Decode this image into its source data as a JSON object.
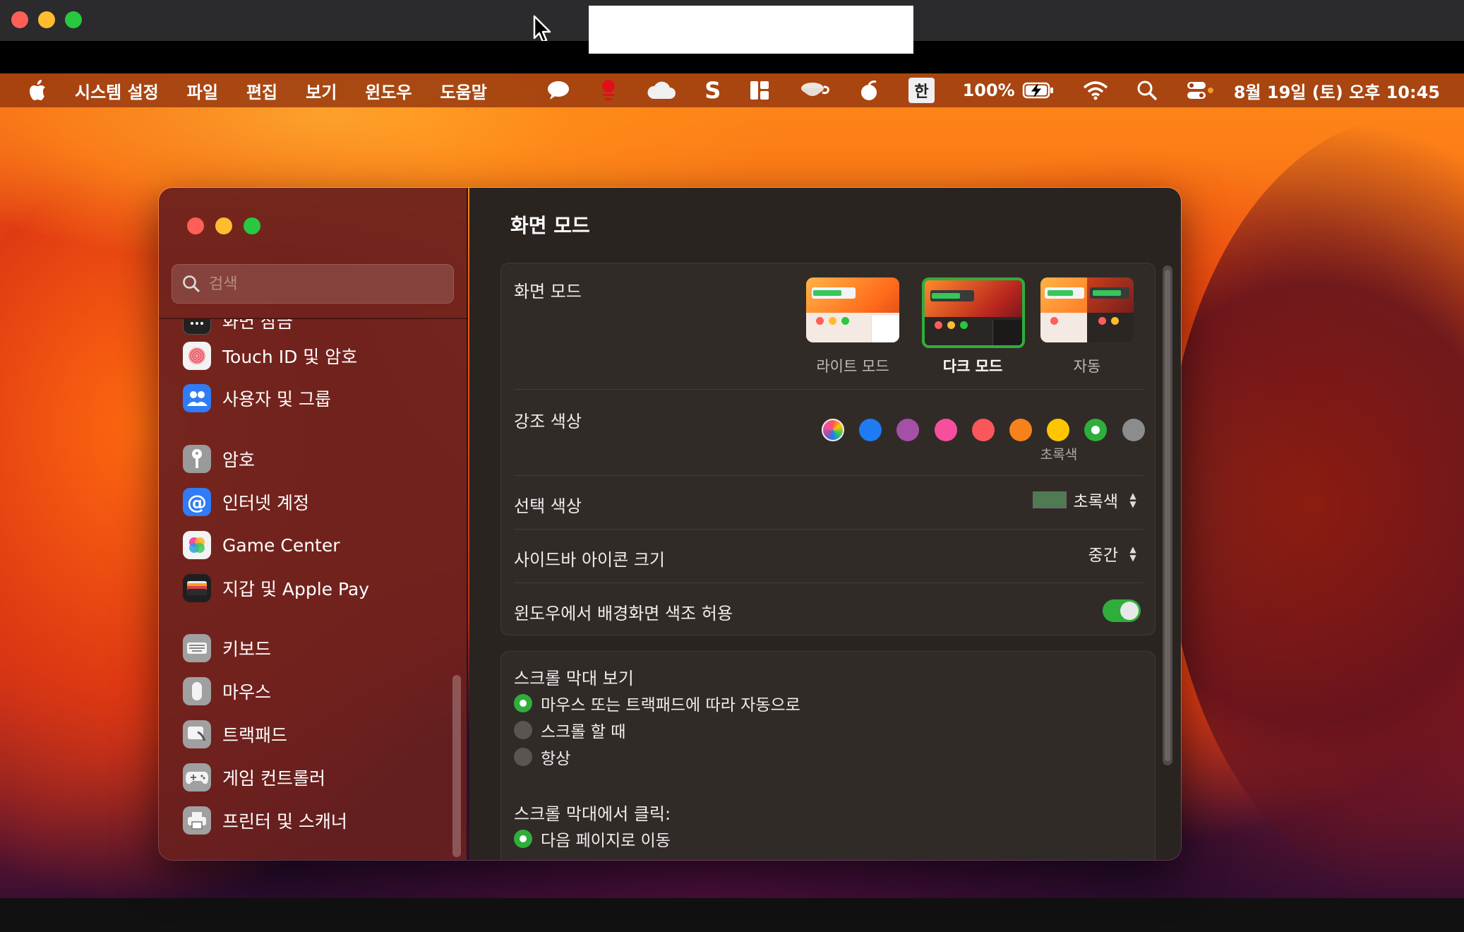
{
  "colors": {
    "accent_green": "#2fae3c",
    "tl_red": "#ff5f57",
    "tl_yellow": "#febc2e",
    "tl_green": "#28c840"
  },
  "menubar": {
    "app": "시스템 설정",
    "menus": [
      "파일",
      "편집",
      "보기",
      "윈도우",
      "도움말"
    ],
    "input_method": "한",
    "battery": "100%",
    "datetime": "8월 19일 (토) 오후 10:45"
  },
  "sidebar": {
    "search_placeholder": "검색",
    "items": [
      {
        "label": "화면 잠금",
        "icon": "lock-screen-icon",
        "color": "#222222"
      },
      {
        "label": "Touch ID 및 암호",
        "icon": "fingerprint-icon",
        "color": "#f2f2f2"
      },
      {
        "label": "사용자 및 그룹",
        "icon": "users-icon",
        "color": "#2f7cf6"
      },
      {
        "label": "암호",
        "icon": "key-icon",
        "color": "#9a9a9a"
      },
      {
        "label": "인터넷 계정",
        "icon": "at-icon",
        "color": "#2f7cf6"
      },
      {
        "label": "Game Center",
        "icon": "game-center-icon",
        "color": "#f2f2f2"
      },
      {
        "label": "지갑 및 Apple Pay",
        "icon": "wallet-icon",
        "color": "#1f1f1f"
      },
      {
        "label": "키보드",
        "icon": "keyboard-icon",
        "color": "#9a9a9a"
      },
      {
        "label": "마우스",
        "icon": "mouse-icon",
        "color": "#9a9a9a"
      },
      {
        "label": "트랙패드",
        "icon": "trackpad-icon",
        "color": "#9a9a9a"
      },
      {
        "label": "게임 컨트롤러",
        "icon": "gamepad-icon",
        "color": "#9a9a9a"
      },
      {
        "label": "프린터 및 스캐너",
        "icon": "printer-icon",
        "color": "#9a9a9a"
      }
    ]
  },
  "main": {
    "title": "화면 모드",
    "appearance": {
      "label": "화면 모드",
      "options": [
        {
          "label": "라이트 모드",
          "selected": false
        },
        {
          "label": "다크 모드",
          "selected": true
        },
        {
          "label": "자동",
          "selected": false
        }
      ]
    },
    "accent": {
      "label": "강조 색상",
      "selected_name": "초록색",
      "swatches": [
        "multicolor",
        "#1f7bf2",
        "#a550a7",
        "#f74f9e",
        "#f9575a",
        "#f7821b",
        "#ffc600",
        "#2fae3c",
        "#8c8c8c"
      ],
      "selected_index": 7
    },
    "highlight": {
      "label": "선택 색상",
      "value": "초록색",
      "swatch_color": "#4f7a52"
    },
    "sidebar_icon_size": {
      "label": "사이드바 아이콘 크기",
      "value": "중간"
    },
    "wallpaper_tint": {
      "label": "윈도우에서 배경화면 색조 허용",
      "on": true
    },
    "scroll_bars": {
      "label": "스크롤 막대 보기",
      "options": [
        {
          "label": "마우스 또는 트랙패드에 따라 자동으로",
          "selected": true
        },
        {
          "label": "스크롤 할 때",
          "selected": false
        },
        {
          "label": "항상",
          "selected": false
        }
      ]
    },
    "scroll_click": {
      "label": "스크롤 막대에서 클릭:",
      "options": [
        {
          "label": "다음 페이지로 이동",
          "selected": true
        }
      ]
    }
  }
}
